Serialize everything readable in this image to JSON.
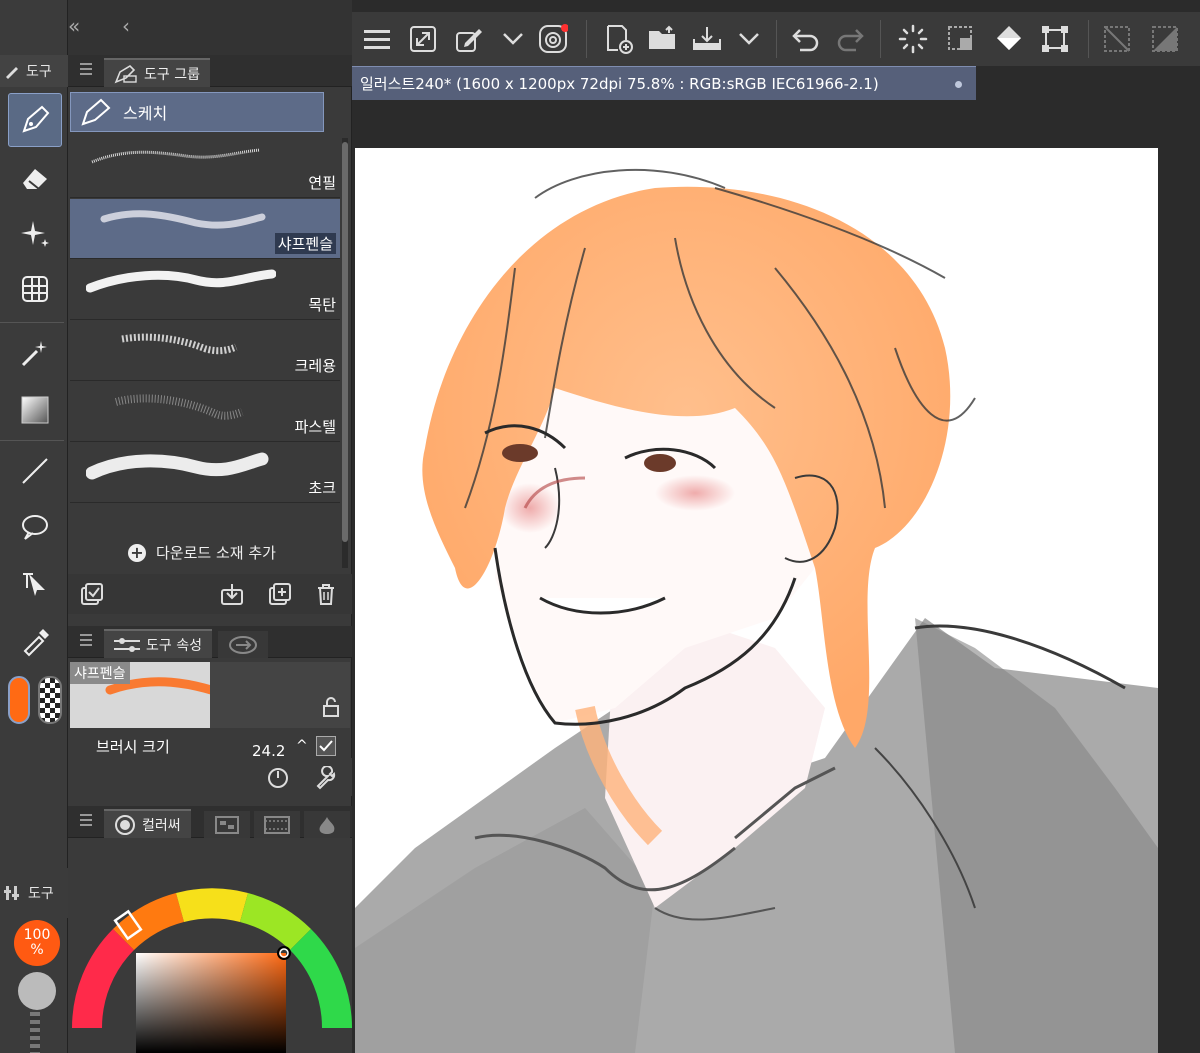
{
  "left_tools": {
    "header": "도구",
    "tools": [
      {
        "name": "pen-tool",
        "active": true
      },
      {
        "name": "eraser-tool",
        "active": false
      },
      {
        "name": "decoration-tool",
        "active": false
      },
      {
        "name": "grid-tool",
        "active": false
      },
      {
        "name": "auto-select-tool",
        "active": false
      },
      {
        "name": "gradient-tool",
        "active": false
      },
      {
        "name": "line-tool",
        "active": false
      },
      {
        "name": "balloon-tool",
        "active": false
      },
      {
        "name": "operation-tool",
        "active": false
      },
      {
        "name": "eyedropper-tool",
        "active": false
      }
    ],
    "main_color": "#ff6a14",
    "sub_color": "transparent",
    "bottom_header": "도구",
    "opacity_value": "100",
    "opacity_unit": "%"
  },
  "panel_collapse": {
    "double": "«",
    "single": "‹"
  },
  "tool_group_tab": {
    "label": "도구 그룹"
  },
  "group": {
    "label": "스케치"
  },
  "brushes": [
    {
      "label": "연필",
      "selected": false
    },
    {
      "label": "샤프펜슬",
      "selected": true
    },
    {
      "label": "목탄",
      "selected": false
    },
    {
      "label": "크레용",
      "selected": false
    },
    {
      "label": "파스텔",
      "selected": false
    },
    {
      "label": "초크",
      "selected": false
    }
  ],
  "add_material": "다운로드 소재 추가",
  "tool_property_tab": {
    "label": "도구 속성"
  },
  "property": {
    "brush_name": "샤프펜슬",
    "size_label": "브러시 크기",
    "size_value": "24.2"
  },
  "color_tab": {
    "label": "컬러써"
  },
  "document_tab": {
    "title": "일러스트240* (1600 x 1200px 72dpi 75.8% : RGB:sRGB IEC61966-2.1)"
  },
  "colors": {
    "accent": "#5d6b88",
    "panel": "#3a3a3a",
    "hair": "#ffb27a",
    "brush_orange": "#ff6a14"
  }
}
